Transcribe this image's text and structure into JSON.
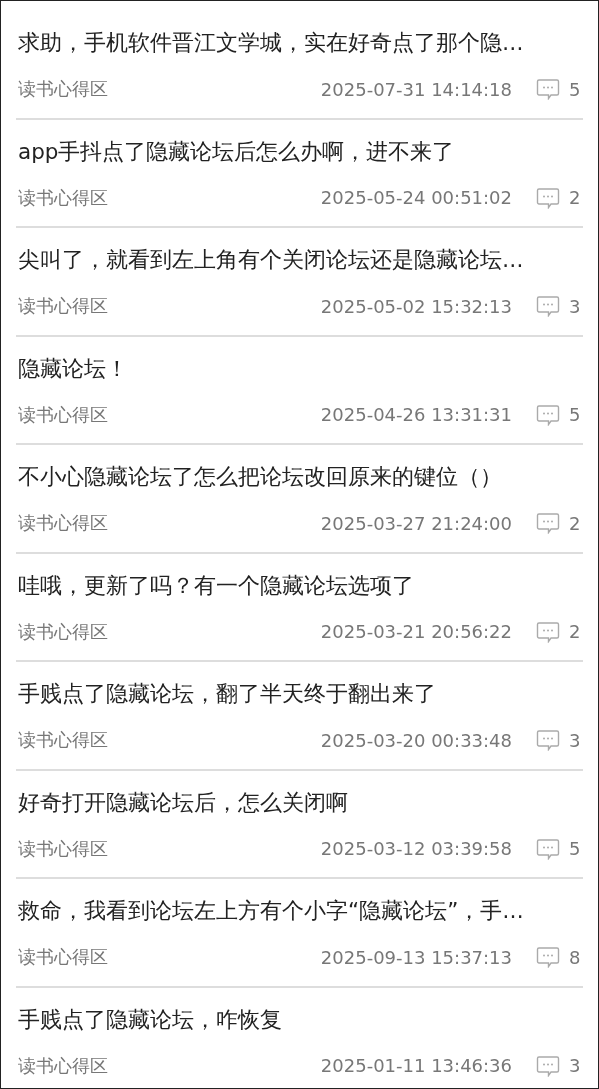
{
  "posts": [
    {
      "title": "求助，手机软件晋江文学城，实在好奇点了那个隐…",
      "board": "读书心得区",
      "time": "2025-07-31 14:14:18",
      "replies": "5"
    },
    {
      "title": "app手抖点了隐藏论坛后怎么办啊，进不来了",
      "board": "读书心得区",
      "time": "2025-05-24 00:51:02",
      "replies": "2"
    },
    {
      "title": "尖叫了，就看到左上角有个关闭论坛还是隐藏论坛…",
      "board": "读书心得区",
      "time": "2025-05-02 15:32:13",
      "replies": "3"
    },
    {
      "title": "隐藏论坛！",
      "board": "读书心得区",
      "time": "2025-04-26 13:31:31",
      "replies": "5"
    },
    {
      "title": "不小心隐藏论坛了怎么把论坛改回原来的键位（）",
      "board": "读书心得区",
      "time": "2025-03-27 21:24:00",
      "replies": "2"
    },
    {
      "title": "哇哦，更新了吗？有一个隐藏论坛选项了",
      "board": "读书心得区",
      "time": "2025-03-21 20:56:22",
      "replies": "2"
    },
    {
      "title": "手贱点了隐藏论坛，翻了半天终于翻出来了",
      "board": "读书心得区",
      "time": "2025-03-20 00:33:48",
      "replies": "3"
    },
    {
      "title": "好奇打开隐藏论坛后，怎么关闭啊",
      "board": "读书心得区",
      "time": "2025-03-12 03:39:58",
      "replies": "5"
    },
    {
      "title": "救命，我看到论坛左上方有个小字“隐藏论坛”，手…",
      "board": "读书心得区",
      "time": "2025-09-13 15:37:13",
      "replies": "8"
    },
    {
      "title": "手贱点了隐藏论坛，咋恢复",
      "board": "读书心得区",
      "time": "2025-01-11 13:46:36",
      "replies": "3"
    }
  ]
}
